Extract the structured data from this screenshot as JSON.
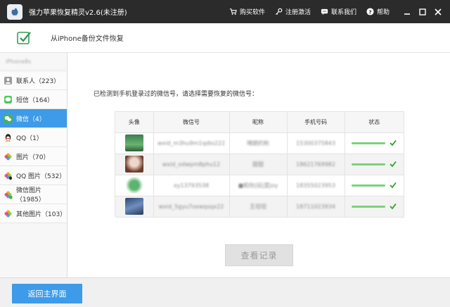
{
  "window": {
    "title": "强力苹果恢复精灵v2.6(未注册)",
    "links": [
      {
        "icon": "cart-icon",
        "label": "购买软件"
      },
      {
        "icon": "key-icon",
        "label": "注册激活"
      },
      {
        "icon": "chat-icon",
        "label": "联系我们"
      },
      {
        "icon": "question-icon",
        "label": "帮助"
      }
    ]
  },
  "subheader": {
    "title": "从iPhone备份文件恢复"
  },
  "sidebar": {
    "device": "iPhone8s",
    "items": [
      {
        "label": "联系人（223）",
        "icon": "contacts-icon",
        "active": false
      },
      {
        "label": "短信（164）",
        "icon": "sms-icon",
        "active": false
      },
      {
        "label": "微信（4）",
        "icon": "wechat-icon",
        "active": true
      },
      {
        "label": "QQ（1）",
        "icon": "qq-icon",
        "active": false
      },
      {
        "label": "图片（70）",
        "icon": "photos-icon",
        "active": false
      },
      {
        "label": "QQ 图片（532）",
        "icon": "qq-photos-icon",
        "active": false
      },
      {
        "label": "微信图片（1985）",
        "icon": "wechat-photos-icon",
        "active": false
      },
      {
        "label": "其他图片（103）",
        "icon": "other-photos-icon",
        "active": false
      }
    ]
  },
  "main": {
    "prompt": "已检测到手机登录过的微信号，请选择需要恢复的微信号：",
    "table": {
      "headers": [
        "头像",
        "微信号",
        "昵称",
        "手机号码",
        "状态"
      ],
      "rows": [
        {
          "wxid": "wxid_m3hu9m1qdlo222",
          "nickname": "晴朗的秋",
          "phone": "15300375843",
          "avatar_color": "#3a7d52"
        },
        {
          "wxid": "wxid_odwpm8phu12",
          "nickname": "甜甜",
          "phone": "18621769982",
          "avatar_color": "#c9a89a"
        },
        {
          "wxid": "xy13793538",
          "nickname": "■和你|玩|耍joy",
          "phone": "18355023953",
          "avatar_color": "#5bb56d"
        },
        {
          "wxid": "wxid_5gyu7oxwqsqx22",
          "nickname": "王坦坦",
          "phone": "18711023934",
          "avatar_color": "#4a6a9c"
        }
      ]
    },
    "view_button": "查看记录"
  },
  "footer": {
    "back_button": "返回主界面"
  },
  "colors": {
    "accent": "#3d9be9",
    "titlebar": "#2b2b2b",
    "status_bar": "#7bd27b",
    "check": "#2aa52a"
  }
}
